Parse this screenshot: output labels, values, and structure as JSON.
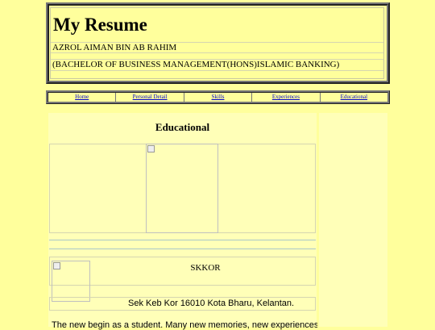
{
  "header": {
    "title": "My Resume",
    "name": "AZROL AIMAN BIN AB RAHIM",
    "degree": "(BACHELOR OF BUSINESS MANAGEMENT(HONS)ISLAMIC BANKING)"
  },
  "nav": {
    "items": [
      {
        "label": "Home"
      },
      {
        "label": "Personal Detail"
      },
      {
        "label": "Skills"
      },
      {
        "label": "Experiences"
      },
      {
        "label": "Educational"
      }
    ]
  },
  "main": {
    "section_title": "Educational",
    "school_name": "SKKOR",
    "school_address": "Sek Keb Kor 16010 Kota Bharu, Kelantan.",
    "paragraph": "The new begin as a student. Many new memories, new experiences and"
  },
  "colors": {
    "page_background": "#ffff9c",
    "content_background": "#ffffb8",
    "link": "#0000cc"
  }
}
